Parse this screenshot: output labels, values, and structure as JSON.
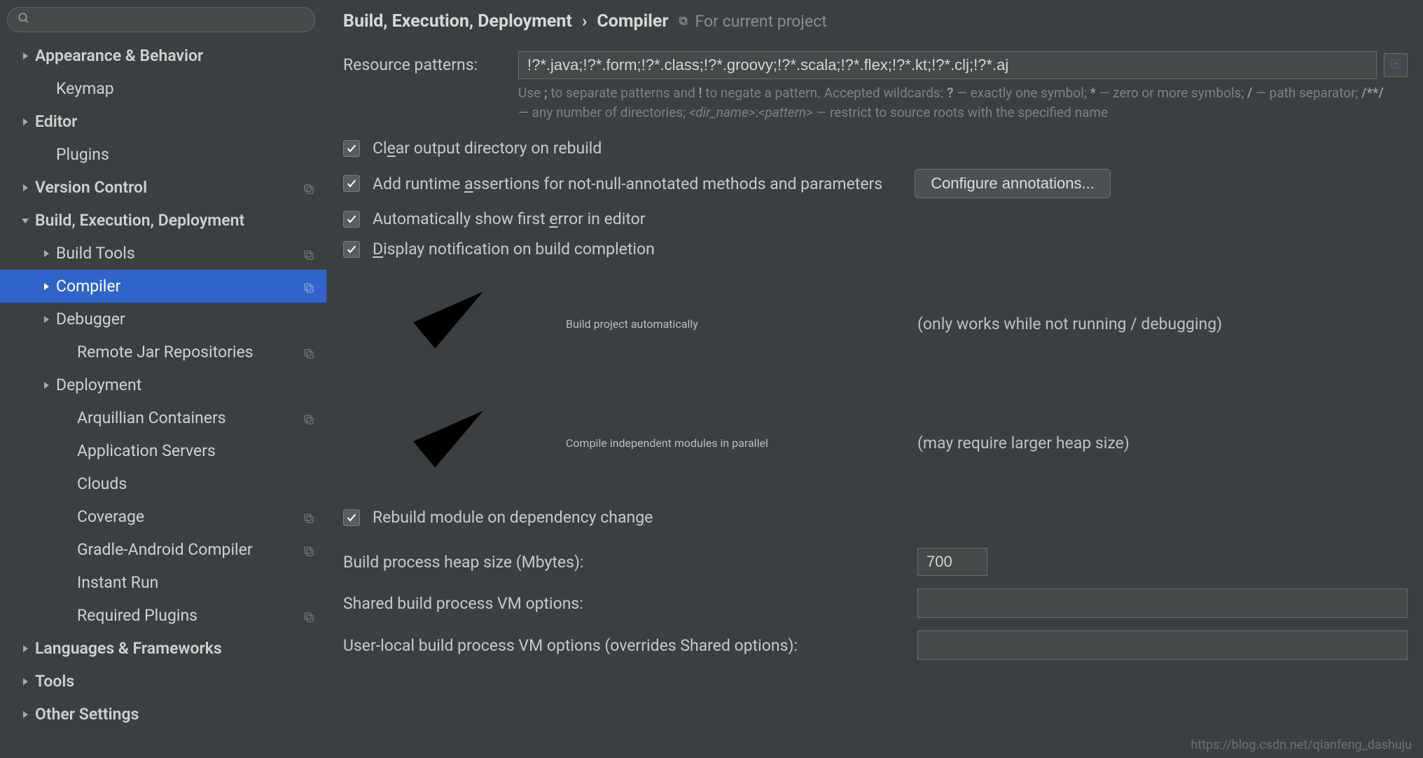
{
  "sidebar": {
    "search_placeholder": "",
    "items": [
      {
        "label": "Appearance & Behavior",
        "depth": 0,
        "arrow": "right",
        "copy": false
      },
      {
        "label": "Keymap",
        "depth": 1,
        "arrow": "",
        "copy": false
      },
      {
        "label": "Editor",
        "depth": 0,
        "arrow": "right",
        "copy": false
      },
      {
        "label": "Plugins",
        "depth": 1,
        "arrow": "",
        "copy": false
      },
      {
        "label": "Version Control",
        "depth": 0,
        "arrow": "right",
        "copy": true
      },
      {
        "label": "Build, Execution, Deployment",
        "depth": 0,
        "arrow": "down",
        "copy": false
      },
      {
        "label": "Build Tools",
        "depth": 1,
        "arrow": "right",
        "copy": true
      },
      {
        "label": "Compiler",
        "depth": 1,
        "arrow": "right",
        "copy": true,
        "selected": true
      },
      {
        "label": "Debugger",
        "depth": 1,
        "arrow": "right",
        "copy": false
      },
      {
        "label": "Remote Jar Repositories",
        "depth": 2,
        "arrow": "",
        "copy": true
      },
      {
        "label": "Deployment",
        "depth": 1,
        "arrow": "right",
        "copy": false
      },
      {
        "label": "Arquillian Containers",
        "depth": 2,
        "arrow": "",
        "copy": true
      },
      {
        "label": "Application Servers",
        "depth": 2,
        "arrow": "",
        "copy": false
      },
      {
        "label": "Clouds",
        "depth": 2,
        "arrow": "",
        "copy": false
      },
      {
        "label": "Coverage",
        "depth": 2,
        "arrow": "",
        "copy": true
      },
      {
        "label": "Gradle-Android Compiler",
        "depth": 2,
        "arrow": "",
        "copy": true
      },
      {
        "label": "Instant Run",
        "depth": 2,
        "arrow": "",
        "copy": false
      },
      {
        "label": "Required Plugins",
        "depth": 2,
        "arrow": "",
        "copy": true
      },
      {
        "label": "Languages & Frameworks",
        "depth": 0,
        "arrow": "right",
        "copy": false
      },
      {
        "label": "Tools",
        "depth": 0,
        "arrow": "right",
        "copy": false
      },
      {
        "label": "Other Settings",
        "depth": 0,
        "arrow": "right",
        "copy": false
      }
    ]
  },
  "breadcrumb": {
    "part1": "Build, Execution, Deployment",
    "sep": "›",
    "part2": "Compiler",
    "project_scope": "For current project"
  },
  "resource_patterns": {
    "label": "Resource patterns:",
    "value": "!?*.java;!?*.form;!?*.class;!?*.groovy;!?*.scala;!?*.flex;!?*.kt;!?*.clj;!?*.aj",
    "hint_plain_1": "Use ",
    "hint_b1": ";",
    "hint_plain_2": " to separate patterns and ",
    "hint_b2": "!",
    "hint_plain_3": " to negate a pattern. Accepted wildcards: ",
    "hint_b3": "?",
    "hint_plain_4": " — exactly one symbol; ",
    "hint_b4": "*",
    "hint_plain_5": " — zero or more symbols; ",
    "hint_b5": "/",
    "hint_plain_6": " — path separator; ",
    "hint_b6": "/**/",
    "hint_plain_7": " — any number of directories; ",
    "hint_i1": "<dir_name>",
    "hint_plain_8": ":",
    "hint_i2": "<pattern>",
    "hint_plain_9": " — restrict to source roots with the specified name"
  },
  "checks": {
    "clear_output": {
      "pre": "Cl",
      "ul": "e",
      "post": "ar output directory on rebuild",
      "checked": true
    },
    "assertions": {
      "pre": "Add runtime ",
      "ul": "a",
      "post": "ssertions for not-null-annotated methods and parameters",
      "checked": true,
      "button": "Configure annotations..."
    },
    "show_first_error": {
      "pre": "Automatically show first ",
      "ul": "e",
      "post": "rror in editor",
      "checked": true
    },
    "display_notification": {
      "pre": "",
      "ul": "D",
      "post": "isplay notification on build completion",
      "checked": true
    },
    "build_auto": {
      "pre": "",
      "ul": "B",
      "post": "uild project automatically",
      "checked": true,
      "extra": "(only works while not running / debugging)"
    },
    "compile_parallel": {
      "pre": "Compile independent ",
      "ul": "m",
      "post": "odules in parallel",
      "checked": false,
      "extra": "(may require larger heap size)"
    },
    "rebuild_dep": {
      "pre": "Rebuild module on dependency chan",
      "ul": "g",
      "post": "e",
      "checked": true
    }
  },
  "fields": {
    "heap": {
      "label": "Build process heap size (Mbytes):",
      "value": "700"
    },
    "shared_vm": {
      "label": "Shared build process VM options:",
      "value": ""
    },
    "user_vm": {
      "label": "User-local build process VM options (overrides Shared options):",
      "value": ""
    }
  },
  "watermark": "https://blog.csdn.net/qianfeng_dashuju"
}
